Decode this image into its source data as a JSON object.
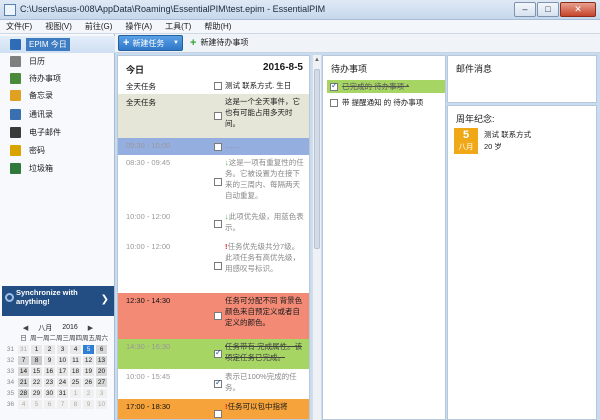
{
  "window": {
    "title": "C:\\Users\\asus-008\\AppData\\Roaming\\EssentialPIM\\test.epim - EssentialPIM",
    "buttons": [
      "–",
      "□",
      "✕"
    ]
  },
  "menu": [
    "文件(F)",
    "视图(V)",
    "前往(G)",
    "操作(A)",
    "工具(T)",
    "帮助(H)"
  ],
  "sidebar": {
    "items": [
      {
        "label": "EPIM 今日",
        "icon": "house-icon",
        "color": "#2e6cb8"
      },
      {
        "label": "日历",
        "icon": "calendar-icon",
        "color": "#7f7f7f"
      },
      {
        "label": "待办事项",
        "icon": "checklist-icon",
        "color": "#4a8a3a"
      },
      {
        "label": "备忘录",
        "icon": "note-icon",
        "color": "#e0a020"
      },
      {
        "label": "通讯录",
        "icon": "contacts-icon",
        "color": "#3a6fb0"
      },
      {
        "label": "电子邮件",
        "icon": "email-icon",
        "color": "#3a3a3a"
      },
      {
        "label": "密码",
        "icon": "key-icon",
        "color": "#d9a400"
      },
      {
        "label": "垃圾箱",
        "icon": "trash-icon",
        "color": "#2f7a3a"
      }
    ]
  },
  "sync": {
    "line1": "Synchronize with",
    "line2": "anything!"
  },
  "calendar": {
    "month": "八月",
    "year": "2016",
    "weekdays": [
      "日",
      "周一",
      "周二",
      "周三",
      "周四",
      "周五",
      "周六"
    ],
    "weeks": [
      {
        "wk": "31",
        "days": [
          {
            "d": "31",
            "c": "other"
          },
          {
            "d": "1",
            "c": ""
          },
          {
            "d": "2",
            "c": ""
          },
          {
            "d": "3",
            "c": ""
          },
          {
            "d": "4",
            "c": ""
          },
          {
            "d": "5",
            "c": "today"
          },
          {
            "d": "6",
            "c": "weekend"
          }
        ]
      },
      {
        "wk": "32",
        "days": [
          {
            "d": "7",
            "c": "weekend"
          },
          {
            "d": "8",
            "c": "mark"
          },
          {
            "d": "9",
            "c": ""
          },
          {
            "d": "10",
            "c": ""
          },
          {
            "d": "11",
            "c": ""
          },
          {
            "d": "12",
            "c": ""
          },
          {
            "d": "13",
            "c": "weekend"
          }
        ]
      },
      {
        "wk": "33",
        "days": [
          {
            "d": "14",
            "c": "weekend"
          },
          {
            "d": "15",
            "c": ""
          },
          {
            "d": "16",
            "c": ""
          },
          {
            "d": "17",
            "c": ""
          },
          {
            "d": "18",
            "c": ""
          },
          {
            "d": "19",
            "c": ""
          },
          {
            "d": "20",
            "c": "weekend"
          }
        ]
      },
      {
        "wk": "34",
        "days": [
          {
            "d": "21",
            "c": "weekend"
          },
          {
            "d": "22",
            "c": ""
          },
          {
            "d": "23",
            "c": ""
          },
          {
            "d": "24",
            "c": ""
          },
          {
            "d": "25",
            "c": ""
          },
          {
            "d": "26",
            "c": ""
          },
          {
            "d": "27",
            "c": "weekend"
          }
        ]
      },
      {
        "wk": "35",
        "days": [
          {
            "d": "28",
            "c": "weekend"
          },
          {
            "d": "29",
            "c": ""
          },
          {
            "d": "30",
            "c": ""
          },
          {
            "d": "31",
            "c": ""
          },
          {
            "d": "1",
            "c": "other"
          },
          {
            "d": "2",
            "c": "other"
          },
          {
            "d": "3",
            "c": "other"
          }
        ]
      },
      {
        "wk": "36",
        "days": [
          {
            "d": "4",
            "c": "other"
          },
          {
            "d": "5",
            "c": "other"
          },
          {
            "d": "6",
            "c": "other"
          },
          {
            "d": "7",
            "c": "other"
          },
          {
            "d": "8",
            "c": "other"
          },
          {
            "d": "9",
            "c": "other"
          },
          {
            "d": "10",
            "c": "other"
          }
        ]
      }
    ]
  },
  "toolbar": {
    "new_task": "新建任务",
    "new_todo": "新建待办事项"
  },
  "day": {
    "title": "今日",
    "date": "2016-8-5",
    "allday_label": "全天任务",
    "allday_checkbox_text": "测试 联系方式. 生日",
    "rows": [
      {
        "time": "全天任务",
        "text": "这是一个全天事件，它也有可能占用多天时间。",
        "bg": "#e6e6d8",
        "checked": false,
        "style": "",
        "prio": "",
        "dark": true
      },
      {
        "time": "09:30 - 10:00",
        "text": "……",
        "bg": "#94aee0",
        "checked": false,
        "style": "gray",
        "prio": "",
        "dark": false
      },
      {
        "time": "08:30 - 09:45",
        "text": "这是一项有重复性的任务。它被设置为在接下来的三周内、每隔两天自动重复。",
        "bg": "#ffffff",
        "checked": false,
        "style": "gray",
        "prio": "↓",
        "dark": false
      },
      {
        "time": "10:00 - 12:00",
        "text": "此项优先级，用蓝色表示。",
        "bg": "#ffffff",
        "checked": false,
        "style": "gray",
        "prio": "↓",
        "dark": false
      },
      {
        "time": "10:00 - 12:00",
        "text": "任务优先级共分7级。此项任务有高优先级，用感叹号标识。",
        "bg": "#ffffff",
        "checked": false,
        "style": "gray",
        "prio": "!",
        "dark": false
      },
      {
        "time": "12:30 - 14:30",
        "text": "任务可分配不同 背景色 颜色来自预定义或者自定义的颜色。",
        "bg": "#f28a76",
        "checked": false,
        "style": "",
        "prio": "",
        "dark": true
      },
      {
        "time": "14:30 - 16:30",
        "text": "任务带有 完成属性。该项定任务已完成。",
        "bg": "#a6d563",
        "checked": true,
        "style": "strike",
        "prio": "",
        "dark": false
      },
      {
        "time": "10:00 - 15:45",
        "text": "表示已100%完成的任务。",
        "bg": "#ffffff",
        "checked": true,
        "style": "gray",
        "prio": "",
        "dark": false
      },
      {
        "time": "17:00 - 18:30",
        "text": "任务可以包中指将",
        "bg": "#f5a33a",
        "checked": false,
        "style": "",
        "prio": "!",
        "dark": true
      }
    ]
  },
  "todo": {
    "title": "待办事项",
    "items": [
      {
        "text": "已完成的 待办事项 *",
        "done": true
      },
      {
        "text": "带 提醒通知 的 待办事项",
        "done": false
      }
    ]
  },
  "mail": {
    "title": "邮件消息"
  },
  "anniversary": {
    "title": "周年纪念:",
    "day": "5",
    "month": "八月",
    "name": "测试 联系方式",
    "age": "20 岁"
  }
}
